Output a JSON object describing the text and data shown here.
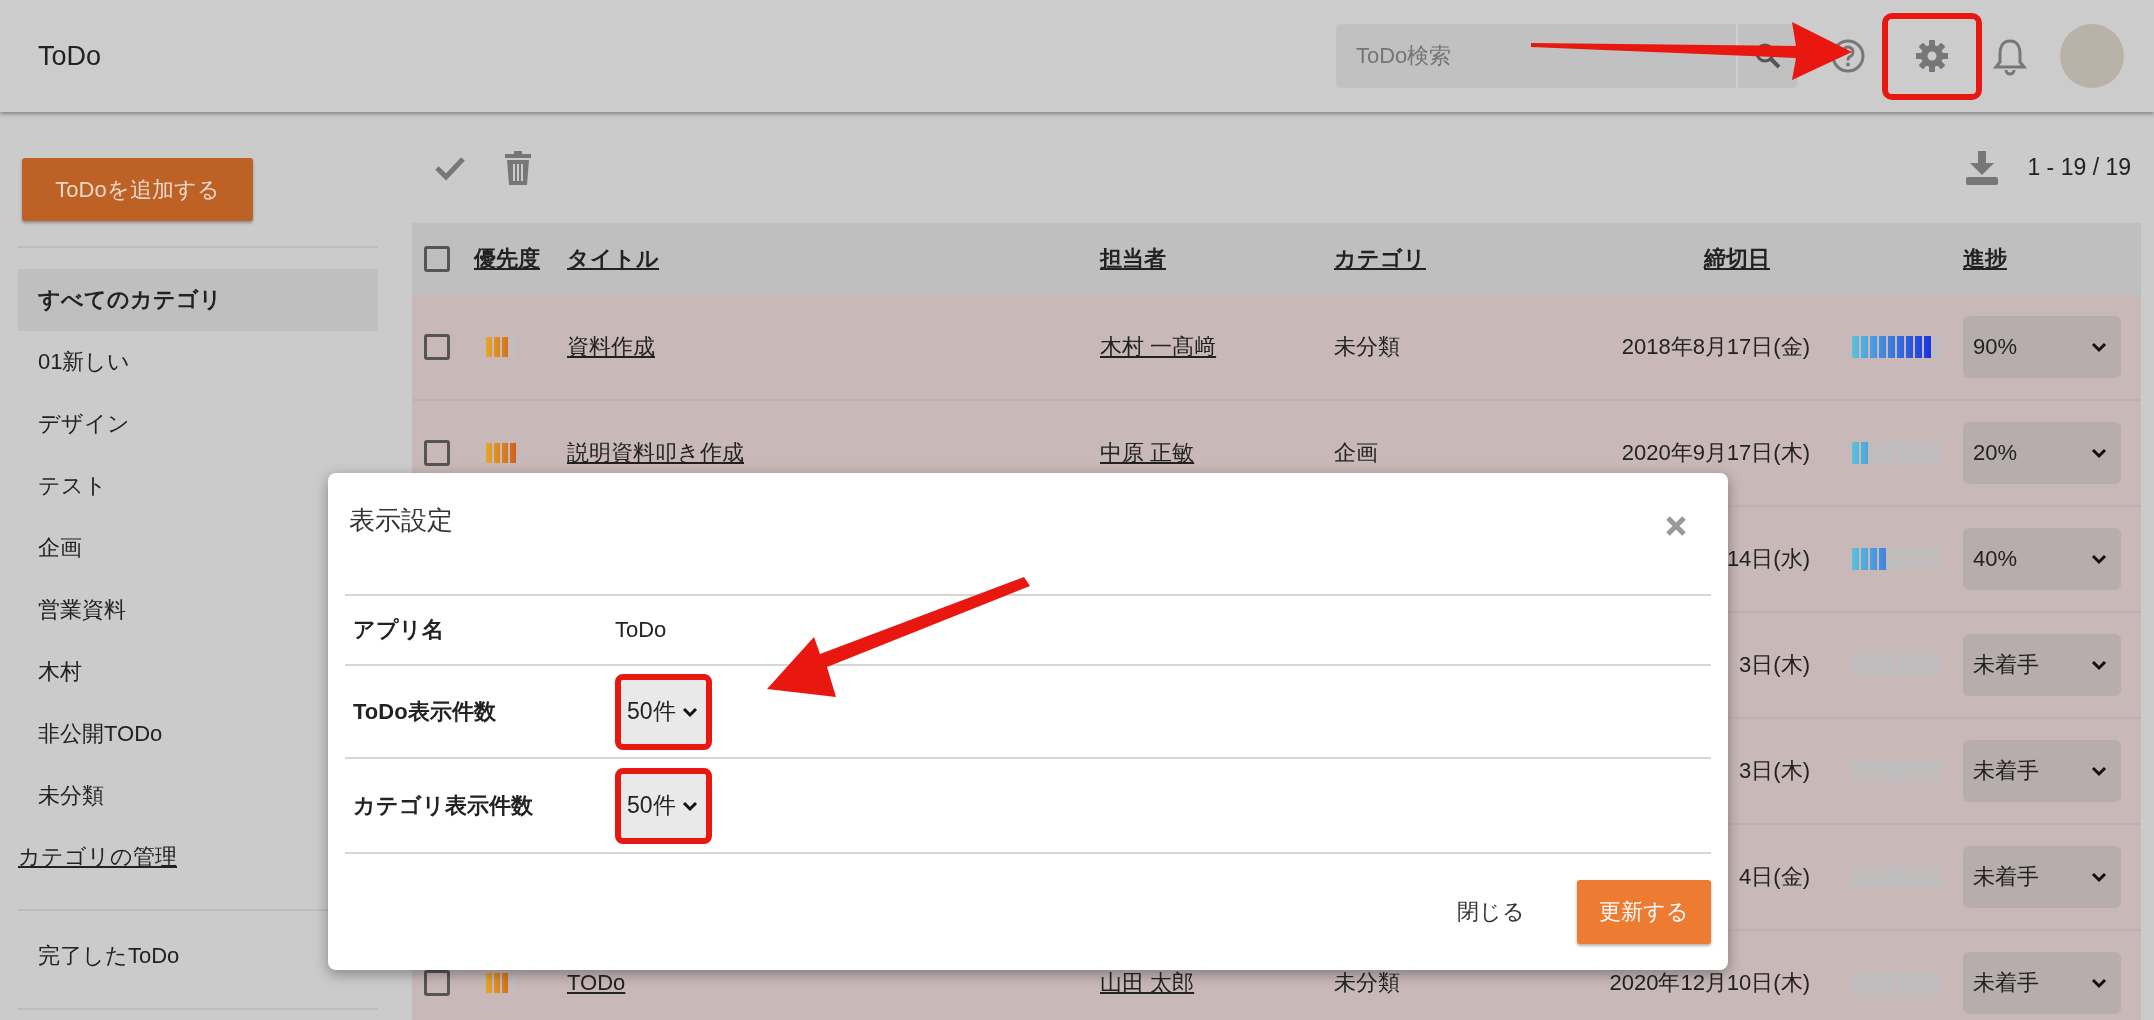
{
  "header": {
    "title": "ToDo",
    "search": {
      "placeholder": "ToDo検索"
    },
    "settings": {
      "highlighted": true
    }
  },
  "sidebar": {
    "add_button": "ToDoを追加する",
    "categories": [
      {
        "label": "すべてのカテゴリ",
        "selected": true
      },
      {
        "label": "01新しい",
        "selected": false
      },
      {
        "label": "デザイン",
        "selected": false
      },
      {
        "label": "テスト",
        "selected": false
      },
      {
        "label": "企画",
        "selected": false
      },
      {
        "label": "営業資料",
        "selected": false
      },
      {
        "label": "木村",
        "selected": false
      },
      {
        "label": "非公開TODo",
        "selected": false
      },
      {
        "label": "未分類",
        "selected": false
      }
    ],
    "manage_link": "カテゴリの管理",
    "completed": "完了したToDo"
  },
  "toolbar": {
    "count": "1 - 19 / 19"
  },
  "table": {
    "select_all": {
      "checked": false
    },
    "columns": [
      "優先度",
      "タイトル",
      "担当者",
      "カテゴリ",
      "締切日",
      "進捗"
    ],
    "rows": [
      {
        "checked": false,
        "priority": {
          "level": 0.75
        },
        "title": "資料作成",
        "assignee": "木村 一髙﨑",
        "category": "未分類",
        "deadline": "2018年8月17日(金)",
        "progress": {
          "level": 0.9
        },
        "status": "90%"
      },
      {
        "checked": false,
        "priority": {
          "level": 1
        },
        "title": "説明資料叩き作成",
        "assignee": "中原 正敏",
        "category": "企画",
        "deadline": "2020年9月17日(木)",
        "progress": {
          "level": 0.2
        },
        "status": "20%"
      },
      {
        "deadline": "14日(水)",
        "progress": {
          "level": 0.4
        },
        "status": "40%"
      },
      {
        "deadline": "3日(木)",
        "progress": {
          "level": 0
        },
        "status": "未着手"
      },
      {
        "deadline": "3日(木)",
        "progress": {
          "level": 0
        },
        "status": "未着手"
      },
      {
        "deadline": "4日(金)",
        "progress": {
          "level": 0
        },
        "status": "未着手"
      },
      {
        "checked": false,
        "priority": {
          "level": 0.75
        },
        "title": "TODo",
        "assignee": "山田 太郎",
        "category": "未分類",
        "deadline": "2020年12月10日(木)",
        "progress": {
          "level": 0
        },
        "status": "未着手"
      }
    ]
  },
  "dialog": {
    "title": "表示設定",
    "fields": [
      {
        "kind": "text",
        "label": "アプリ名",
        "value": "ToDo"
      },
      {
        "kind": "select",
        "label": "ToDo表示件数",
        "value": "50件",
        "highlighted": true
      },
      {
        "kind": "select",
        "label": "カテゴリ表示件数",
        "value": "50件",
        "highlighted": true
      }
    ],
    "buttons": [
      {
        "kind": "text",
        "label": "閉じる"
      },
      {
        "kind": "primary",
        "label": "更新する"
      }
    ]
  }
}
